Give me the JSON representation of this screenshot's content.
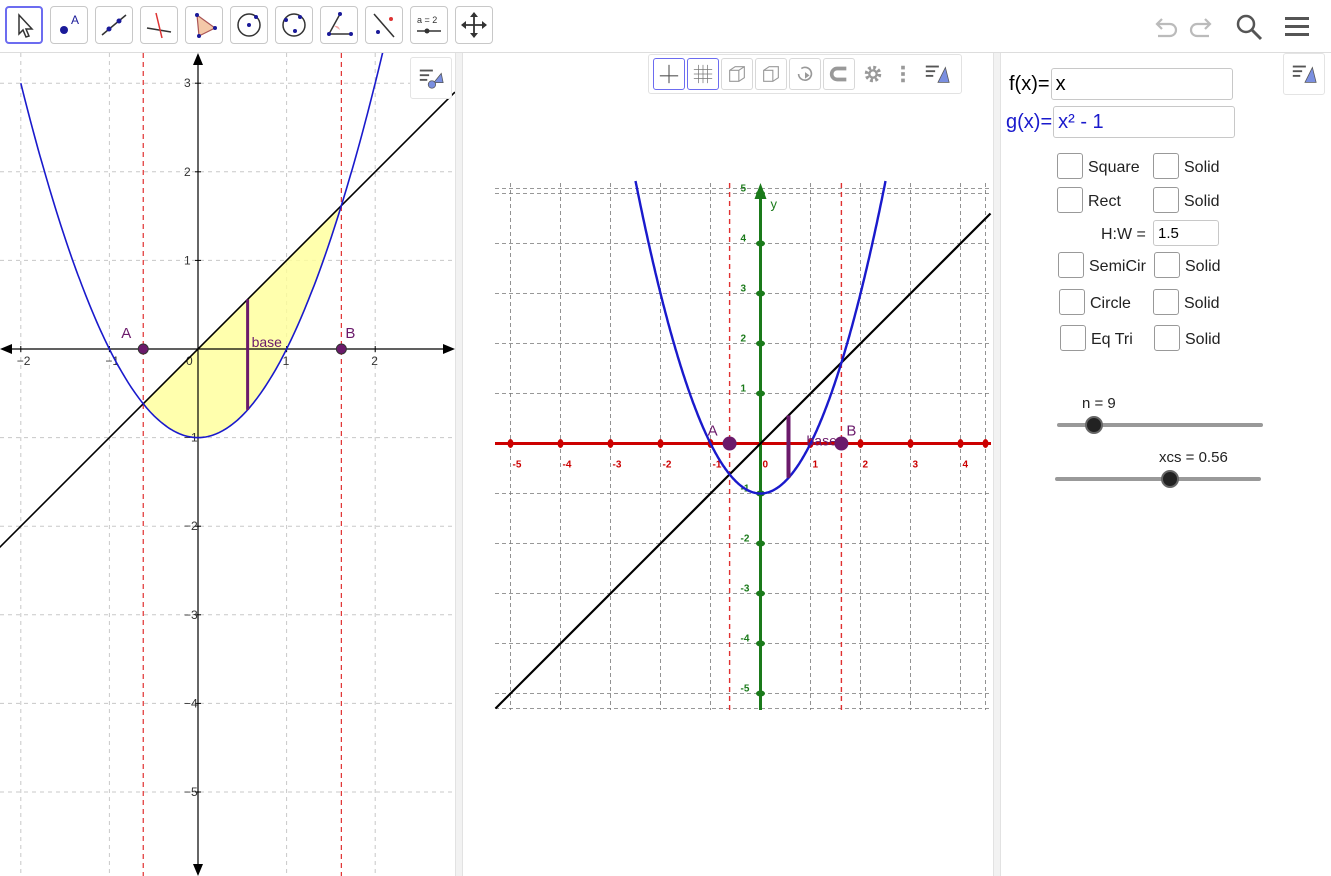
{
  "toolbar": {
    "tools": [
      "move-icon",
      "point-icon",
      "line-icon",
      "perpendicular-line-icon",
      "polygon-icon",
      "circle-icon",
      "circle-through-points-icon",
      "angle-icon",
      "reflect-icon",
      "slider-icon",
      "move-graphics-view-icon"
    ],
    "slider_tool_label": "a = 2",
    "right": [
      "undo-icon",
      "redo-icon",
      "search-icon",
      "menu-icon"
    ]
  },
  "graphics1": {
    "x_ticks": [
      "−2",
      "−1",
      "0",
      "1",
      "2"
    ],
    "y_ticks": [
      "3",
      "2",
      "1",
      "−1",
      "−2",
      "−3",
      "−4",
      "−5"
    ],
    "point_a": "A",
    "point_b": "B",
    "base_label": "base"
  },
  "graphics3d": {
    "x_ticks": [
      "-5",
      "-4",
      "-3",
      "-2",
      "-1",
      "0",
      "1",
      "2",
      "3",
      "4"
    ],
    "y_ticks": [
      "5",
      "4",
      "3",
      "2",
      "1",
      "-1",
      "-2",
      "-3",
      "-4",
      "-5"
    ],
    "y_axis_label": "y",
    "point_a": "A",
    "point_b": "B",
    "base_label": "base"
  },
  "algebra": {
    "f_label": "f(x)=",
    "f_value": "x",
    "g_label": "g(x)=",
    "g_value": "x² - 1",
    "checkboxes": [
      {
        "label": "Square",
        "solid": "Solid"
      },
      {
        "label": "Rect",
        "solid": "Solid"
      },
      {
        "label": "SemiCir",
        "solid": "Solid"
      },
      {
        "label": "Circle",
        "solid": "Solid"
      },
      {
        "label": "Eq Tri",
        "solid": "Solid"
      }
    ],
    "hw_label": "H:W =",
    "hw_value": "1.5",
    "slider_n_label": "n = 9",
    "slider_n_value": 9,
    "slider_xcs_label": "xcs = 0.56",
    "slider_xcs_value": 0.56
  },
  "colors": {
    "parabola": "#1a1acc",
    "line": "#000000",
    "region": "#ffff99",
    "points": "#6b1a6b",
    "dashed": "#e03030",
    "x_axis_3d": "#cc0000",
    "y_axis_3d": "#1a7a1a"
  }
}
